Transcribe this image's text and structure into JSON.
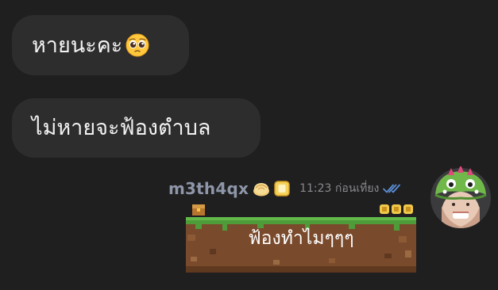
{
  "messages": {
    "incoming": [
      {
        "text": "หายนะคะ",
        "emoji": "pleading-face-emoji"
      },
      {
        "text": "ไม่หายจะฟ้องตำบล"
      }
    ],
    "outgoing": {
      "username": "m3th4qx",
      "badges": [
        "bun-badge-icon",
        "toast-badge-icon"
      ],
      "time": "11:23 ก่อนเที่ยง",
      "status_icon": "double-check-read-icon",
      "sticker_text": "ฟ้องทำไมๆๆๆ"
    }
  },
  "colors": {
    "background": "#1f1f20",
    "bubble": "#2d2d2e",
    "text": "#f2f2f2",
    "username": "#8e96a8",
    "time": "#8a8a8f",
    "read_check": "#5b8fd6",
    "grass": "#63b84a",
    "dirt": "#7a4a2c"
  }
}
